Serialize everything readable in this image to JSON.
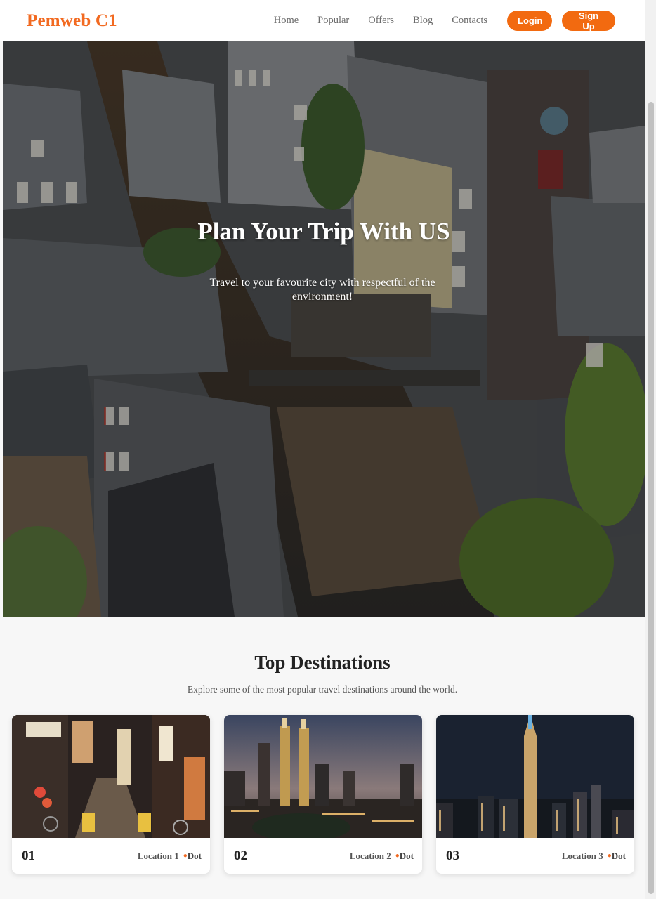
{
  "header": {
    "brand": "Pemweb C1",
    "nav": [
      "Home",
      "Popular",
      "Offers",
      "Blog",
      "Contacts"
    ],
    "login_label": "Login",
    "signup_label": "Sign Up"
  },
  "hero": {
    "title": "Plan Your Trip With US",
    "subtitle": "Travel to your favourite city with respectful of the environment!"
  },
  "destinations": {
    "title": "Top Destinations",
    "subtitle": "Explore some of the most popular travel destinations around the world.",
    "cards": [
      {
        "number": "01",
        "location": "Location 1",
        "dot_label": "Dot"
      },
      {
        "number": "02",
        "location": "Location 2",
        "dot_label": "Dot"
      },
      {
        "number": "03",
        "location": "Location 3",
        "dot_label": "Dot"
      }
    ]
  },
  "colors": {
    "accent": "#f26a21",
    "button": "#f26a10",
    "page_bg": "#f7f7f7"
  },
  "icons": {
    "dot": "bullet-dot-icon"
  }
}
